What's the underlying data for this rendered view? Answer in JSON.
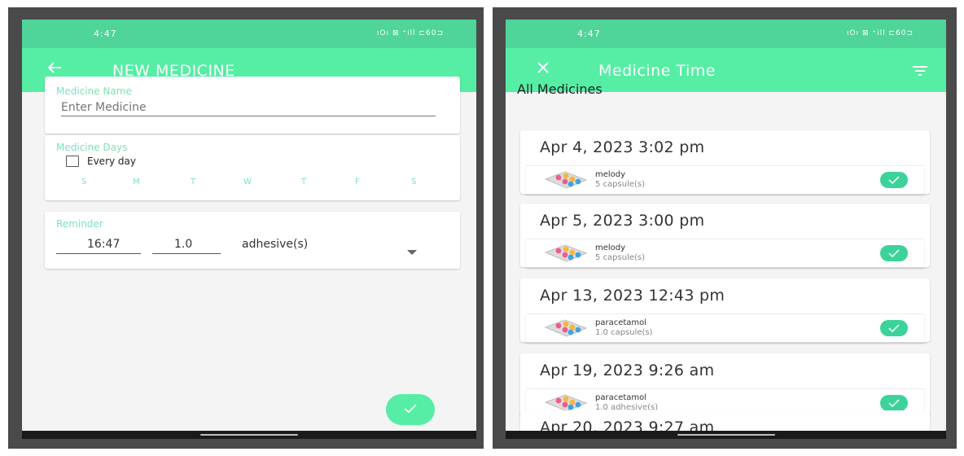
{
  "left_screen": {
    "status_time": "4:47",
    "status_icons": "ıOı ⊠ ⁺ill ⊏60⊐",
    "appbar_title": "NEW MEDICINE",
    "medicine_name": {
      "label": "Medicine Name",
      "placeholder": "Enter Medicine"
    },
    "medicine_days": {
      "label": "Medicine Days",
      "every_day_label": "Every day",
      "days": [
        "S",
        "M",
        "T",
        "W",
        "T",
        "F",
        "S"
      ]
    },
    "reminder": {
      "label": "Reminder",
      "time": "16:47",
      "amount": "1.0",
      "unit": "adhesive(s)"
    }
  },
  "right_screen": {
    "status_time": "4:47",
    "status_icons": "ıOı ⊠ ⁺ill ⊏60⊐",
    "appbar_title": "Medicine Time",
    "section_title": "All Medicines",
    "entries": [
      {
        "date": "Apr 4, 2023 3:02 pm",
        "name": "melody",
        "dose": "5 capsule(s)"
      },
      {
        "date": "Apr 5, 2023 3:00 pm",
        "name": "melody",
        "dose": "5 capsule(s)"
      },
      {
        "date": "Apr 13, 2023 12:43 pm",
        "name": "paracetamol",
        "dose": "1.0 capsule(s)"
      },
      {
        "date": "Apr 19, 2023 9:26 am",
        "name": "paracetamol",
        "dose": "1.0 adhesive(s)"
      },
      {
        "date": "Apr 20, 2023 9:27 am"
      }
    ]
  },
  "colors": {
    "appbar": "#55eea4",
    "status_bar": "#4fd49a",
    "accent_label": "#7be3b4",
    "check": "#3cd39a"
  }
}
